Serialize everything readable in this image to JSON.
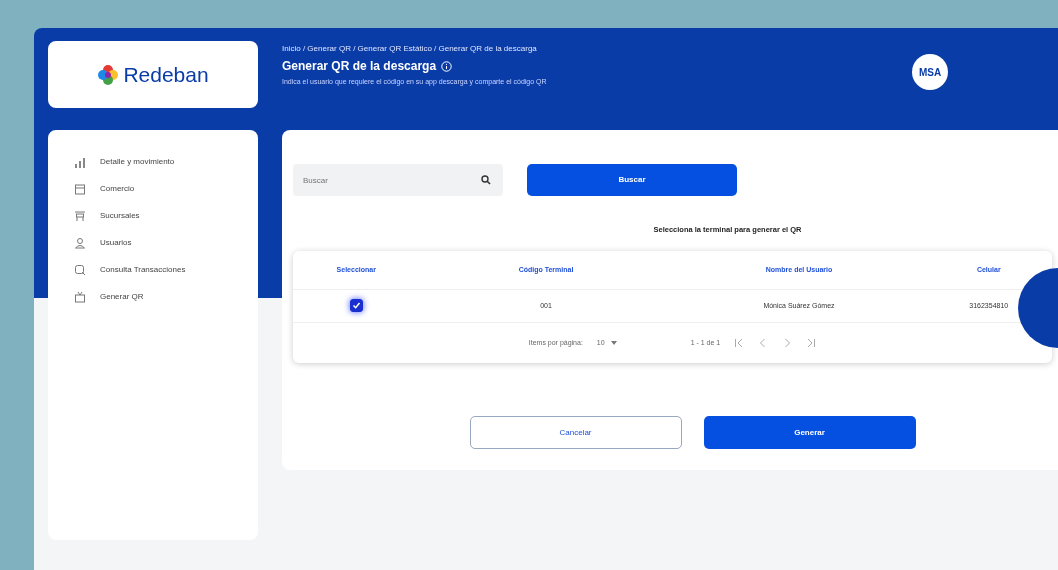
{
  "logo": {
    "text": "Redeban"
  },
  "header": {
    "breadcrumb": "Inicio / Generar QR / Generar QR Estático / Generar QR de la descarga",
    "title": "Generar QR de la descarga",
    "subtitle": "Indica el usuario que requiere el código en su app descarga y comparte el código QR",
    "avatar": "MSA"
  },
  "sidebar": {
    "items": [
      {
        "label": "Detalle y movimiento"
      },
      {
        "label": "Comercio"
      },
      {
        "label": "Sucursales"
      },
      {
        "label": "Usuarios"
      },
      {
        "label": "Consulta Transacciones"
      },
      {
        "label": "Generar QR"
      }
    ]
  },
  "search": {
    "placeholder": "Buscar"
  },
  "search_button": "Buscar",
  "instruction": "Selecciona la terminal para generar el QR",
  "table": {
    "columns": [
      "Seleccionar",
      "Código Terminal",
      "Nombre del Usuario",
      "Celular"
    ],
    "rows": [
      {
        "checked": true,
        "cells": [
          "",
          "001",
          "Mónica Suárez Gómez",
          "3162354810"
        ]
      }
    ]
  },
  "pagination": {
    "per_page_label": "Items por página:",
    "per_page": "10",
    "range": "1 - 1 de 1"
  },
  "buttons": [
    {
      "label": "Cancelar",
      "kind": "outline"
    },
    {
      "label": "Generar",
      "kind": "primary"
    }
  ]
}
